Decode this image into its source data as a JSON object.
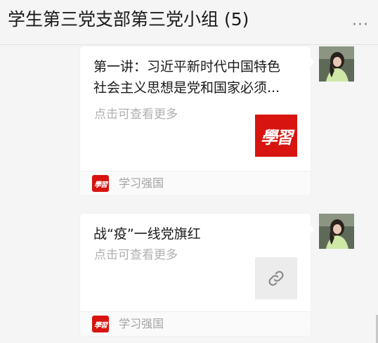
{
  "header": {
    "chat_title": "学生第三党支部第三党小组 (5)",
    "more_label": "···"
  },
  "messages": [
    {
      "title": "第一讲：习近平新时代中国特色\n社会主义思想是党和国家必须...",
      "description": "点击可查看更多",
      "thumbnail": "xuexi-logo",
      "thumbnail_text": "學習",
      "source_name": "学习强国",
      "source_icon_text": "學習"
    },
    {
      "title": "战“疫”一线党旗红",
      "description": "点击可查看更多",
      "thumbnail": "link-icon",
      "source_name": "学习强国",
      "source_icon_text": "學習"
    }
  ],
  "colors": {
    "brand_red": "#d7140f",
    "background": "#f5f5f5",
    "card": "#ffffff"
  }
}
